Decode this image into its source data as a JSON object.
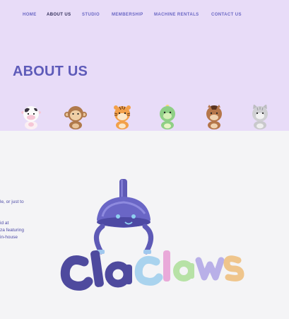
{
  "nav": {
    "items": [
      {
        "label": "HOME"
      },
      {
        "label": "ABOUT US"
      },
      {
        "label": "STUDIO"
      },
      {
        "label": "MEMBERSHIP"
      },
      {
        "label": "MACHINE RENTALS"
      },
      {
        "label": "CONTACT US"
      }
    ],
    "active_index": 1
  },
  "page_title": "ABOUT US",
  "mascots": [
    {
      "icon": "cow-figurine-icon"
    },
    {
      "icon": "monkey-figurine-icon"
    },
    {
      "icon": "tiger-figurine-icon"
    },
    {
      "icon": "dragon-figurine-icon"
    },
    {
      "icon": "horse-figurine-icon"
    },
    {
      "icon": "cat-figurine-icon"
    }
  ],
  "body_text_fragments": [
    "le, or just to",
    "id at",
    "za featuring",
    "in-house"
  ],
  "logo_text": "Cla Claws",
  "colors": {
    "hero_bg": "#e8dcf8",
    "accent": "#5e5bb9",
    "nav_active": "#2f2c57",
    "content_bg": "#f4f4f6"
  }
}
